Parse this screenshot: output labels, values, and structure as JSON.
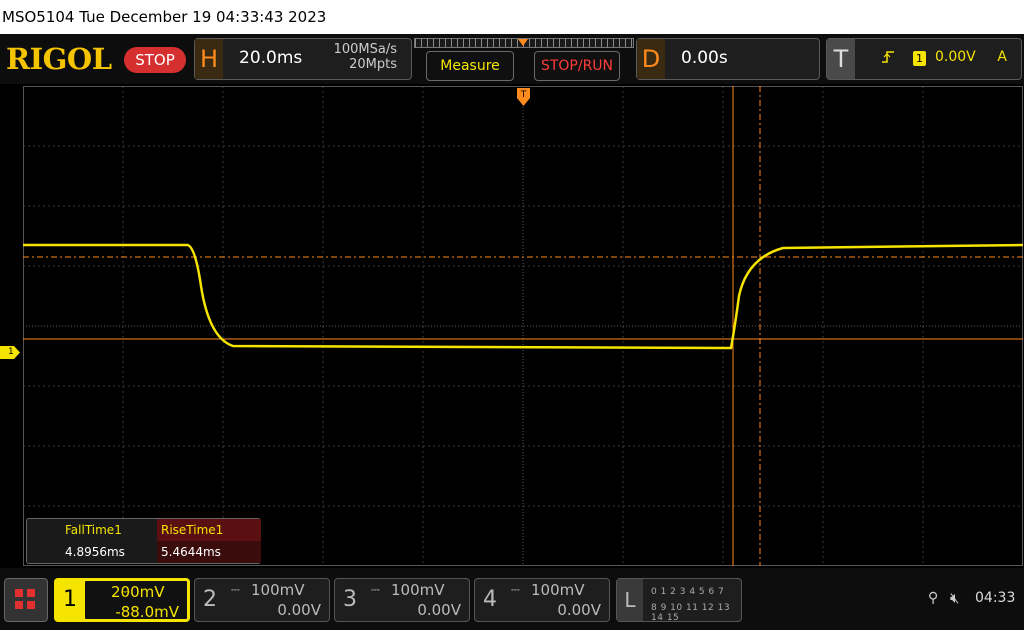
{
  "title_bar": {
    "text": "MSO5104  Tue December 19 04:33:43 2023"
  },
  "top_bar": {
    "logo": "RIGOL",
    "run_state": "STOP",
    "horizontal": {
      "letter": "H",
      "timebase": "20.0ms",
      "sample_rate": "100MSa/s",
      "memory_depth": "20Mpts"
    },
    "measure_button": "Measure",
    "stoprun_button": "STOP/RUN",
    "delay": {
      "letter": "D",
      "value": "0.00s"
    },
    "trigger": {
      "letter": "T",
      "edge_icon": "rising-edge-icon",
      "source": "1",
      "level": "0.00V",
      "mode": "A"
    }
  },
  "waveform": {
    "trigger_marker_label": "T",
    "channel_marker_label": "1",
    "trace_color": "#f5e400",
    "cursor_color": "#ff8a1e"
  },
  "measurements": {
    "headers": [
      "FallTime1",
      "RiseTime1"
    ],
    "values": [
      "4.8956ms",
      "5.4644ms"
    ]
  },
  "channels": [
    {
      "num": "1",
      "scale": "200mV",
      "offset": "-88.0mV",
      "active": true
    },
    {
      "num": "2",
      "scale": "100mV",
      "offset": "0.00V",
      "active": false
    },
    {
      "num": "3",
      "scale": "100mV",
      "offset": "0.00V",
      "active": false
    },
    {
      "num": "4",
      "scale": "100mV",
      "offset": "0.00V",
      "active": false
    }
  ],
  "logic": {
    "letter": "L",
    "row1": "0 1 2 3  4 5 6 7",
    "row2": "8 9 10 11 12 13 14 15"
  },
  "status": {
    "time": "04:33",
    "icons": [
      "usb-icon",
      "speaker-muted-icon"
    ]
  }
}
